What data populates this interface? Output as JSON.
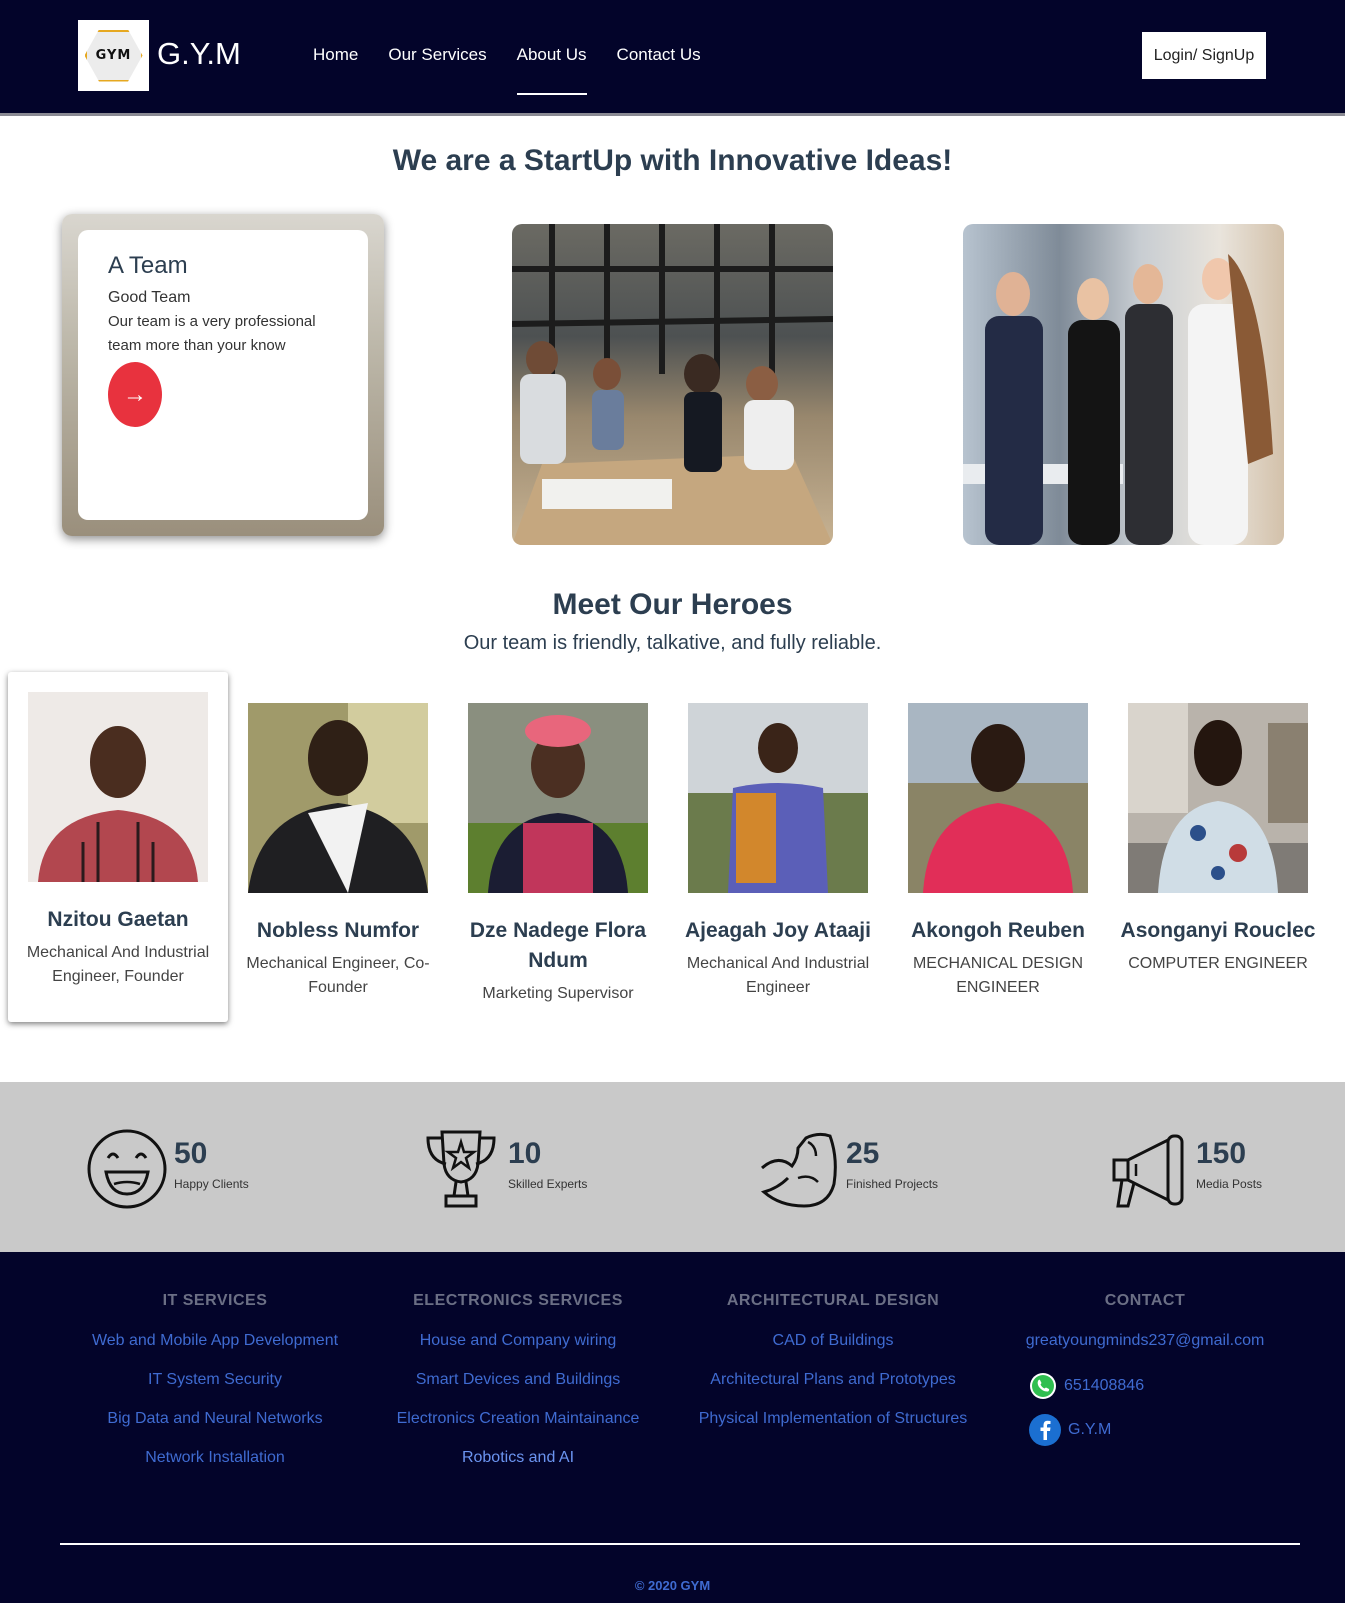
{
  "nav": {
    "logo_text": "GYM",
    "brand": "G.Y.M",
    "links": [
      "Home",
      "Our Services",
      "About Us",
      "Contact Us"
    ],
    "active_index": 2,
    "login_label": "Login/ SignUp"
  },
  "hero": {
    "title": "We are a StartUp with Innovative Ideas!",
    "card": {
      "title": "A Team",
      "subtitle": "Good Team",
      "text": "Our team is a very professional team more than your know",
      "arrow": "→"
    }
  },
  "heroes": {
    "title": "Meet Our Heroes",
    "subtitle": "Our team is friendly, talkative, and fully reliable.",
    "members": [
      {
        "name": "Nzitou Gaetan",
        "role": "Mechanical And Industrial Engineer, Founder"
      },
      {
        "name": "Nobless Numfor",
        "role": "Mechanical Engineer, Co-Founder"
      },
      {
        "name": "Dze Nadege Flora Ndum",
        "role": "Marketing Supervisor"
      },
      {
        "name": "Ajeagah Joy Ataaji",
        "role": "Mechanical And Industrial Engineer"
      },
      {
        "name": "Akongoh Reuben",
        "role": "MECHANICAL DESIGN ENGINEER"
      },
      {
        "name": "Asonganyi Rouclec",
        "role": "COMPUTER ENGINEER"
      }
    ]
  },
  "stats": [
    {
      "icon": "smiley-icon",
      "value": "50",
      "label": "Happy Clients"
    },
    {
      "icon": "trophy-icon",
      "value": "10",
      "label": "Skilled Experts"
    },
    {
      "icon": "muscle-arm-icon",
      "value": "25",
      "label": "Finished Projects"
    },
    {
      "icon": "megaphone-icon",
      "value": "150",
      "label": "Media Posts"
    }
  ],
  "footer": {
    "columns": [
      {
        "title": "IT SERVICES",
        "links": [
          "Web and Mobile App Development",
          "IT System Security",
          "Big Data and Neural Networks",
          "Network Installation"
        ]
      },
      {
        "title": "ELECTRONICS SERVICES",
        "links": [
          "House and Company wiring",
          "Smart Devices and Buildings",
          "Electronics Creation Maintainance",
          "Robotics and AI"
        ]
      },
      {
        "title": "ARCHITECTURAL DESIGN",
        "links": [
          "CAD of Buildings",
          "Architectural Plans and Prototypes",
          "Physical Implementation of Structures"
        ]
      }
    ],
    "contact": {
      "title": "CONTACT",
      "email": "greatyoungminds237@gmail.com",
      "phone": "651408846",
      "facebook": "G.Y.M"
    },
    "copyright": "© 2020 GYM",
    "colors": {
      "background": "#03042a",
      "link": "#3f6bd1"
    }
  }
}
